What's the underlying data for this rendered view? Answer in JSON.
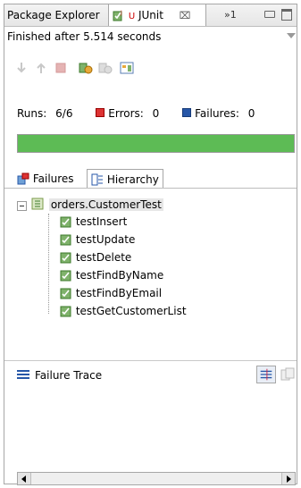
{
  "tabs": {
    "package_explorer": "Package Explorer",
    "junit": "JUnit",
    "junit_close": "⌧",
    "overflow": "»1"
  },
  "status": {
    "text": "Finished after 5.514 seconds"
  },
  "toolbar": {
    "icons": [
      "next-failure-icon",
      "previous-failure-icon",
      "stop-icon",
      "rerun-icon",
      "rerun-failed-icon",
      "history-icon"
    ]
  },
  "counters": {
    "runs_label": "Runs:",
    "runs_value": "6/6",
    "errors_label": "Errors:",
    "errors_value": "0",
    "failures_label": "Failures:",
    "failures_value": "0"
  },
  "progress": {
    "fraction": 1.0,
    "color": "#5dbb55"
  },
  "subtabs": {
    "failures": "Failures",
    "hierarchy": "Hierarchy"
  },
  "tree": {
    "root": "orders.CustomerTest",
    "tests": [
      "testInsert",
      "testUpdate",
      "testDelete",
      "testFindByName",
      "testFindByEmail",
      "testGetCustomerList"
    ]
  },
  "trace": {
    "title": "Failure Trace"
  },
  "colors": {
    "accent_blue": "#2757a8",
    "error_red": "#d33",
    "pass_green": "#5dbb55"
  }
}
